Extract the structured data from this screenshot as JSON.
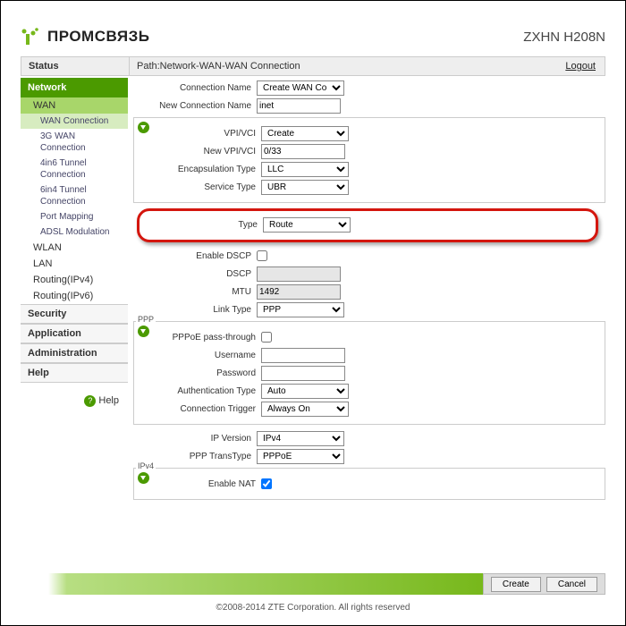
{
  "header": {
    "brand": "ПРОМСВЯЗЬ",
    "model": "ZXHN H208N"
  },
  "statusbar": {
    "label": "Status",
    "path": "Path:Network-WAN-WAN Connection",
    "logout": "Logout"
  },
  "sidebar": {
    "cats": {
      "status": "Status",
      "network": "Network",
      "security": "Security",
      "application": "Application",
      "administration": "Administration",
      "help": "Help"
    },
    "network_items": {
      "wan": "WAN",
      "wlan": "WLAN",
      "lan": "LAN",
      "routing4": "Routing(IPv4)",
      "routing6": "Routing(IPv6)"
    },
    "wan_subs": {
      "wan_conn": "WAN Connection",
      "wan_3g": "3G WAN Connection",
      "t4in6": "4in6 Tunnel Connection",
      "t6in4": "6in4 Tunnel Connection",
      "portmap": "Port Mapping",
      "adsl": "ADSL Modulation"
    },
    "help_link": "Help"
  },
  "form": {
    "conn_name_lbl": "Connection Name",
    "conn_name_val": "Create WAN Conne",
    "new_conn_lbl": "New Connection Name",
    "new_conn_val": "inet",
    "vpi_lbl": "VPI/VCI",
    "vpi_val": "Create",
    "new_vpi_lbl": "New VPI/VCI",
    "new_vpi_val": "0/33",
    "encap_lbl": "Encapsulation Type",
    "encap_val": "LLC",
    "svc_lbl": "Service Type",
    "svc_val": "UBR",
    "type_lbl": "Type",
    "type_val": "Route",
    "enable_dscp_lbl": "Enable DSCP",
    "dscp_lbl": "DSCP",
    "dscp_val": "",
    "mtu_lbl": "MTU",
    "mtu_val": "1492",
    "link_lbl": "Link Type",
    "link_val": "PPP",
    "ppp_tag": "PPP",
    "ppp_pass_lbl": "PPPoE pass-through",
    "user_lbl": "Username",
    "user_val": "",
    "pass_lbl": "Password",
    "pass_val": "",
    "auth_lbl": "Authentication Type",
    "auth_val": "Auto",
    "trig_lbl": "Connection Trigger",
    "trig_val": "Always On",
    "ipver_lbl": "IP Version",
    "ipver_val": "IPv4",
    "ppptrans_lbl": "PPP TransType",
    "ppptrans_val": "PPPoE",
    "ipv4_tag": "IPv4",
    "nat_lbl": "Enable NAT"
  },
  "footer": {
    "create": "Create",
    "cancel": "Cancel",
    "copyright": "©2008-2014 ZTE Corporation. All rights reserved"
  }
}
